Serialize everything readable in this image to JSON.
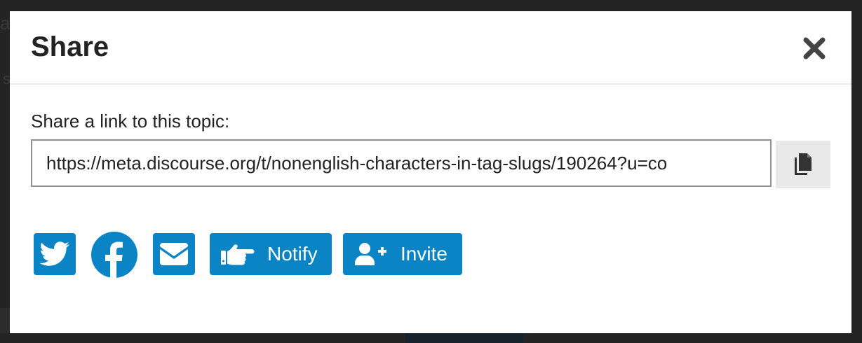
{
  "modal": {
    "title": "Share",
    "close_icon": "close-icon"
  },
  "share": {
    "label": "Share a link to this topic:",
    "link_value": "https://meta.discourse.org/t/nonenglish-characters-in-tag-slugs/190264?u=co",
    "copy_icon": "copy-icon"
  },
  "buttons": {
    "twitter_icon": "twitter-icon",
    "facebook_icon": "facebook-icon",
    "email_icon": "envelope-icon",
    "notify_label": "Notify",
    "notify_icon": "hand-point-right-icon",
    "invite_label": "Invite",
    "invite_icon": "user-plus-icon"
  },
  "colors": {
    "accent": "#0a84c5",
    "overlay": "#232323",
    "copy_bg": "#e9e9e9"
  }
}
